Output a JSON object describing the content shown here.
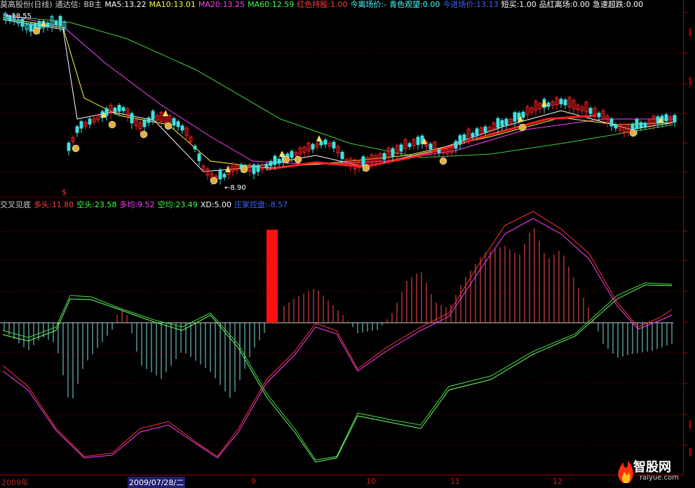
{
  "header": {
    "title": "莫高股份(日线)",
    "formula": "通达信:",
    "indicator_name": "BB主",
    "ma5": "MA5:13.22",
    "ma10": "MA10:13.01",
    "ma20": "MA20:13.25",
    "ma60": "MA60:12.59",
    "red_hold": "红色持股:1.00",
    "entry_price": "今离场价:-",
    "cyan_watch": "青色观望:0.00",
    "entry_price2": "今进场价:13.13",
    "short_buy": "短买:1.00",
    "red_exit": "品红离场:0.00",
    "sharp_drop": "急速超跌:0.00",
    "colors": {
      "title": "#d0d0d0",
      "ma5": "#ffffff",
      "ma10": "#ffff00",
      "ma20": "#ff40ff",
      "ma60": "#40ff40",
      "red_hold": "#ff4040",
      "entry_price": "#40ffff",
      "cyan_watch": "#40ffff",
      "entry_price2": "#4040ff",
      "short_buy": "#ffffff",
      "red_exit": "#ffffff",
      "sharp_drop": "#ffffff"
    }
  },
  "price_pane": {
    "max_label": "←18.55",
    "min_label": "←8.90"
  },
  "indicator": {
    "name": "交叉见底",
    "bull": "多头:11.80",
    "bear": "空头:23.58",
    "bull_avg": "多均:9.52",
    "bear_avg": "空均:23.49",
    "xd": "XD:5.00",
    "main_control": "庄家控盘:-8.57",
    "colors": {
      "name": "#d0d0d0",
      "bull": "#ff4040",
      "bear": "#40ff40",
      "bull_avg": "#ff40ff",
      "bear_avg": "#40ff40",
      "xd": "#ffffff",
      "main_control": "#4040ff"
    }
  },
  "date_axis": {
    "year_label": "2009年",
    "cursor_date": "2009/07/28/二",
    "months": [
      "9",
      "10",
      "11",
      "12"
    ]
  },
  "watermark": {
    "title": "智股网",
    "url": "raiyue.com"
  },
  "chart_data": {
    "type": "candlestick",
    "title": "莫高股份(日线)",
    "price_max": 18.55,
    "price_min": 8.9,
    "moving_averages": [
      "MA5",
      "MA10",
      "MA20",
      "MA60"
    ],
    "ma_values": {
      "MA5": 13.22,
      "MA10": 13.01,
      "MA20": 13.25,
      "MA60": 12.59
    },
    "indicator_values": {
      "多头": 11.8,
      "空头": 23.58,
      "多均": 9.52,
      "空均": 23.49,
      "XD": 5.0,
      "庄家控盘": -8.57
    },
    "x_months": [
      "2009年",
      "9",
      "10",
      "11",
      "12"
    ]
  }
}
